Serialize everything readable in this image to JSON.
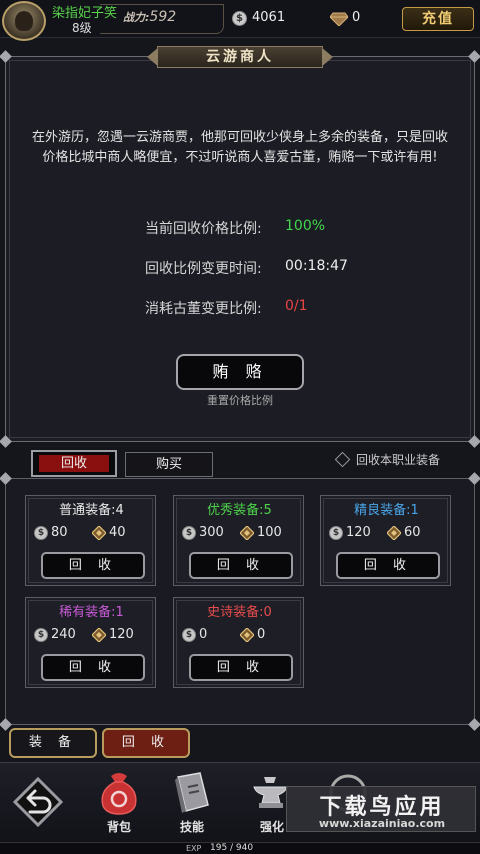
{
  "player": {
    "name": "染指妃子笑",
    "level": "8级",
    "power_label": "战力:",
    "power_value": "592"
  },
  "currency": {
    "coins": "4061",
    "gems": "0",
    "recharge_label": "充值"
  },
  "merchant": {
    "title": "云游商人",
    "description": "在外游历，忽遇一云游商贾，他那可回收少侠身上多余的装备，只是回收价格比城中商人略便宜，不过听说商人喜爱古董，贿赂一下或许有用!",
    "rows": [
      {
        "label": "当前回收价格比例:",
        "value": "100%",
        "color": "#3fd84a"
      },
      {
        "label": "回收比例变更时间:",
        "value": "00:18:47",
        "color": "#eeeeee"
      },
      {
        "label": "消耗古董变更比例:",
        "value": "0/1",
        "color": "#e64545"
      }
    ],
    "bribe_label": "贿 赂",
    "reset_label": "重置价格比例"
  },
  "tabs": {
    "recycle": "回收",
    "buy": "购买",
    "only_class": "回收本职业装备"
  },
  "categories": [
    {
      "title": "普通装备:",
      "count": "4",
      "color": "#e8e8e8",
      "coin": "80",
      "gem": "40",
      "button": "回 收"
    },
    {
      "title": "优秀装备:",
      "count": "5",
      "color": "#4ed34a",
      "coin": "300",
      "gem": "100",
      "button": "回 收"
    },
    {
      "title": "精良装备:",
      "count": "1",
      "color": "#4aa5e8",
      "coin": "120",
      "gem": "60",
      "button": "回 收"
    },
    {
      "title": "稀有装备:",
      "count": "1",
      "color": "#c65ad4",
      "coin": "240",
      "gem": "120",
      "button": "回 收"
    },
    {
      "title": "史诗装备:",
      "count": "0",
      "color": "#e64c4c",
      "coin": "0",
      "gem": "0",
      "button": "回 收"
    }
  ],
  "bottom_tabs": {
    "equip": "装 备",
    "recycle": "回 收"
  },
  "nav": {
    "bag": "背包",
    "skills": "技能",
    "strengthen": "强化"
  },
  "exp": {
    "label": "EXP",
    "value": "195 / 940"
  },
  "watermark": {
    "main": "下载鸟应用",
    "sub": "www.xiazainiao.com"
  },
  "icons": {
    "coin": "coin-icon",
    "gem": "diamond-icon",
    "back": "back-arrow-icon",
    "bag": "bag-icon",
    "skills": "book-icon",
    "strengthen": "anvil-icon"
  }
}
